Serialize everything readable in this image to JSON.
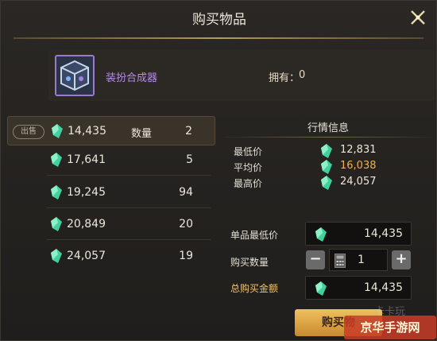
{
  "dialog": {
    "title": "购买物品"
  },
  "item": {
    "name": "装扮合成器",
    "owned_label": "拥有：",
    "owned_value": "0"
  },
  "sell_list": {
    "badge": "出售",
    "qty_label": "数量",
    "rows": [
      {
        "price": "14,435",
        "qty": "2"
      },
      {
        "price": "17,641",
        "qty": "5"
      },
      {
        "price": "19,245",
        "qty": "94"
      },
      {
        "price": "20,849",
        "qty": "20"
      },
      {
        "price": "24,057",
        "qty": "19"
      }
    ]
  },
  "market": {
    "title": "行情信息",
    "min_label": "最低价",
    "min_value": "12,831",
    "avg_label": "平均价",
    "avg_value": "16,038",
    "max_label": "最高价",
    "max_value": "24,057"
  },
  "buy_form": {
    "unit_min_label": "单品最低价",
    "unit_min_value": "14,435",
    "qty_label": "购买数量",
    "qty_value": "1",
    "total_label": "总购买金额",
    "total_value": "14,435",
    "minus": "−",
    "plus": "+"
  },
  "buy_button": "购买物",
  "watermark": {
    "text": "京华手游网",
    "ghost": "卡卡玩"
  },
  "colors": {
    "gem": "#3fd1a0",
    "avg_price": "#f2b04a",
    "item_name": "#b98ce8",
    "buy_button": "#e0a848"
  },
  "icons": [
    "close-icon",
    "item-cube-icon",
    "gem-currency-icon",
    "calculator-icon"
  ]
}
